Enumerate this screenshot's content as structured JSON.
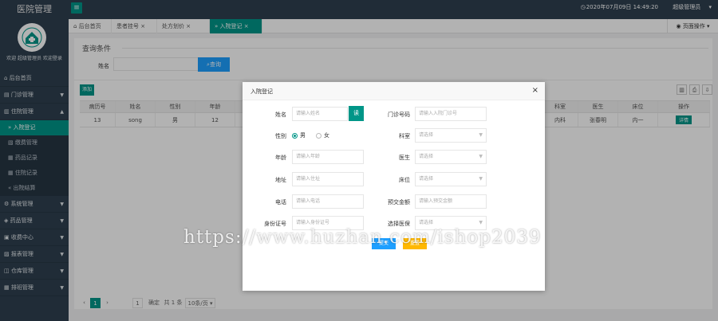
{
  "app": {
    "title": "医院管理",
    "datetime": "2020年07月09日 14:49:20",
    "user_menu": "超级管理员"
  },
  "user": {
    "greeting": "欢迎 超级管理员 欢迎登录"
  },
  "sidebar": {
    "items": [
      {
        "label": "后台首页"
      },
      {
        "label": "门诊管理"
      },
      {
        "label": "住院管理"
      },
      {
        "label": "系统管理"
      },
      {
        "label": "药品管理"
      },
      {
        "label": "收费中心"
      },
      {
        "label": "报表管理"
      },
      {
        "label": "仓库管理"
      },
      {
        "label": "排班管理"
      }
    ],
    "sub": [
      {
        "label": "入院登记"
      },
      {
        "label": "缴费管理"
      },
      {
        "label": "药品记录"
      },
      {
        "label": "住院记录"
      },
      {
        "label": "出院结算"
      }
    ]
  },
  "tabs": [
    {
      "label": "后台首页"
    },
    {
      "label": "患者挂号"
    },
    {
      "label": "处方划价"
    },
    {
      "label": "入院登记"
    }
  ],
  "tab_right": "页面操作",
  "search": {
    "section_title": "查询条件",
    "label": "姓名",
    "button": "查询"
  },
  "toolbar": {
    "add": "添加"
  },
  "table": {
    "headers": [
      "病历号",
      "姓名",
      "性别",
      "年龄",
      "科室",
      "医生",
      "床位",
      "操作"
    ],
    "row": [
      "13",
      "song",
      "男",
      "12",
      "内科",
      "张春明",
      "内一",
      "详情"
    ]
  },
  "pager": {
    "current": "1",
    "goto": "1",
    "confirm": "确定",
    "total": "共 1 条",
    "page_size": "10条/页"
  },
  "modal": {
    "title": "入院登记",
    "close": "×",
    "read_card": "读",
    "fields": {
      "name": {
        "label": "姓名",
        "placeholder": "请输入姓名"
      },
      "outpatient_no": {
        "label": "门诊号码",
        "placeholder": "请输入入院门诊号"
      },
      "gender": {
        "label": "性别",
        "male": "男",
        "female": "女"
      },
      "department": {
        "label": "科室",
        "placeholder": "请选择"
      },
      "age": {
        "label": "年龄",
        "placeholder": "请输入年龄"
      },
      "doctor": {
        "label": "医生",
        "placeholder": "请选择"
      },
      "address": {
        "label": "地址",
        "placeholder": "请输入住址"
      },
      "bed": {
        "label": "床位",
        "placeholder": "请选择"
      },
      "phone": {
        "label": "电话",
        "placeholder": "请输入电话"
      },
      "deposit": {
        "label": "预交金额",
        "placeholder": "请输入预交金额"
      },
      "id_card": {
        "label": "身份证号",
        "placeholder": "请输入身份证号"
      },
      "insurance": {
        "label": "选择医保",
        "placeholder": "请选择"
      }
    },
    "submit": "提交",
    "reset": "重置"
  },
  "watermark": "https://www.huzhan.com/ishop2039"
}
